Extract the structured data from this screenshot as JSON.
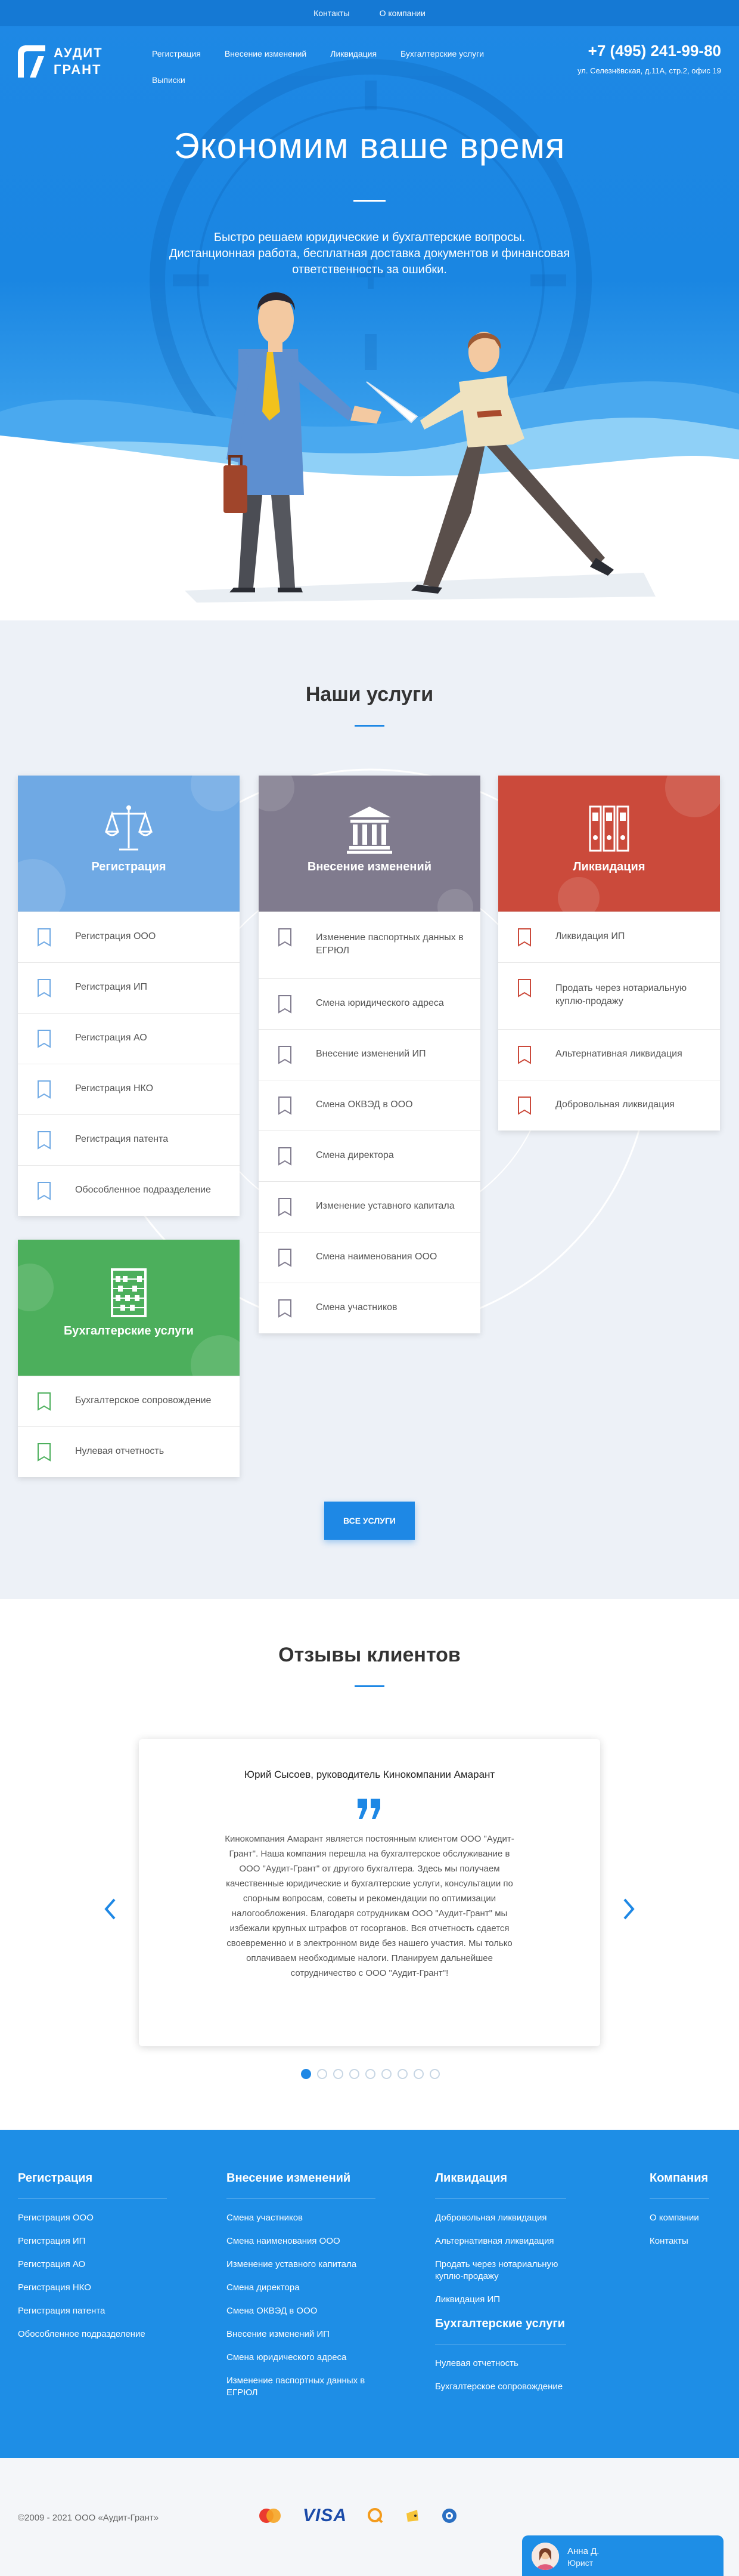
{
  "topbar": {
    "contacts": "Контакты",
    "about": "О компании"
  },
  "logo": {
    "line1": "АУДИТ",
    "line2": "ГРАНТ"
  },
  "nav": [
    "Регистрация",
    "Внесение изменений",
    "Ликвидация",
    "Бухгалтерские услуги",
    "Выписки"
  ],
  "contact": {
    "phone": "+7 (495) 241-99-80",
    "address": "ул. Селезнёвская, д.11А, стр.2, офис 19"
  },
  "hero": {
    "title": "Экономим ваше время",
    "subtitle_lines": [
      "Быстро решаем юридические и бухгалтерские вопросы.",
      "Дистанционная работа, бесплатная доставка документов и финансовая",
      "ответственность за ошибки."
    ]
  },
  "services": {
    "title": "Наши услуги",
    "cards": [
      {
        "title": "Регистрация",
        "color": "#6fa9e4",
        "icon": "scales-icon",
        "items": [
          "Регистрация ООО",
          "Регистрация ИП",
          "Регистрация АО",
          "Регистрация НКО",
          "Регистрация патента",
          "Обособленное подразделение"
        ]
      },
      {
        "title": "Внесение изменений",
        "color": "#807b8e",
        "icon": "courthouse-icon",
        "items": [
          "Изменение паспортных данных в ЕГРЮЛ",
          "Смена юридического адреса",
          "Внесение изменений ИП",
          "Смена ОКВЭД в ООО",
          "Смена директора",
          "Изменение уставного капитала",
          "Смена наименования ООО",
          "Смена участников"
        ]
      },
      {
        "title": "Ликвидация",
        "color": "#cb4a3b",
        "icon": "binders-icon",
        "items": [
          "Ликвидация ИП",
          "Продать через нотариальную куплю-продажу",
          "Альтернативная ликвидация",
          "Добровольная ликвидация"
        ]
      },
      {
        "title": "Бухгалтерские услуги",
        "color": "#4caf5c",
        "icon": "abacus-icon",
        "items": [
          "Бухгалтерское сопровождение",
          "Нулевая отчетность"
        ]
      }
    ],
    "button": "ВСЕ УСЛУГИ"
  },
  "reviews": {
    "title": "Отзывы клиентов",
    "author": "Юрий Сысоев, руководитель Кинокомпании Амарант",
    "text_lines": [
      "Кинокомпания Амарант является постоянным клиентом ООО \"Аудит-",
      "Грант\". Наша компания перешла на бухгалтерское обслуживание в",
      "ООО \"Аудит-Грант\" от другого бухгалтера. Здесь мы получаем",
      "качественные юридические и бухгалтерские услуги, консультации по",
      "спорным вопросам, советы и рекомендации по оптимизации",
      "налогообложения. Благодаря сотрудникам ООО \"Аудит-Грант\" мы",
      "избежали крупных штрафов от госорганов. Вся отчетность сдается",
      "своевременно и в электронном виде без нашего участия. Мы только",
      "оплачиваем необходимые налоги. Планируем дальнейшее",
      "сотрудничество с ООО \"Аудит-Грант\"!"
    ],
    "dots_count": 9,
    "active_dot": 0
  },
  "footer": {
    "cols": [
      {
        "title": "Регистрация",
        "links": [
          "Регистрация ООО",
          "Регистрация ИП",
          "Регистрация АО",
          "Регистрация НКО",
          "Регистрация патента",
          "Обособленное подразделение"
        ]
      },
      {
        "title": "Внесение изменений",
        "links": [
          "Смена участников",
          "Смена наименования ООО",
          "Изменение уставного капитала",
          "Смена директора",
          "Смена ОКВЭД в ООО",
          "Внесение изменений ИП",
          "Смена юридического адреса",
          "Изменение паспортных данных в ЕГРЮЛ"
        ]
      },
      {
        "title": "Ликвидация",
        "links": [
          "Добровольная ликвидация",
          "Альтернативная ликвидация",
          "Продать через нотариальную куплю-продажу",
          "Ликвидация ИП"
        ]
      },
      {
        "title": "Компания",
        "links": [
          "О компании",
          "Контакты"
        ]
      }
    ],
    "accounting": {
      "title": "Бухгалтерские услуги",
      "links": [
        "Нулевая отчетность",
        "Бухгалтерское сопровождение"
      ]
    }
  },
  "bottom": {
    "copyright": "©2009 - 2021 ООО «Аудит-Грант»",
    "visa": "VISA"
  },
  "chat": {
    "name": "Анна Д.",
    "role": "Юрист"
  }
}
